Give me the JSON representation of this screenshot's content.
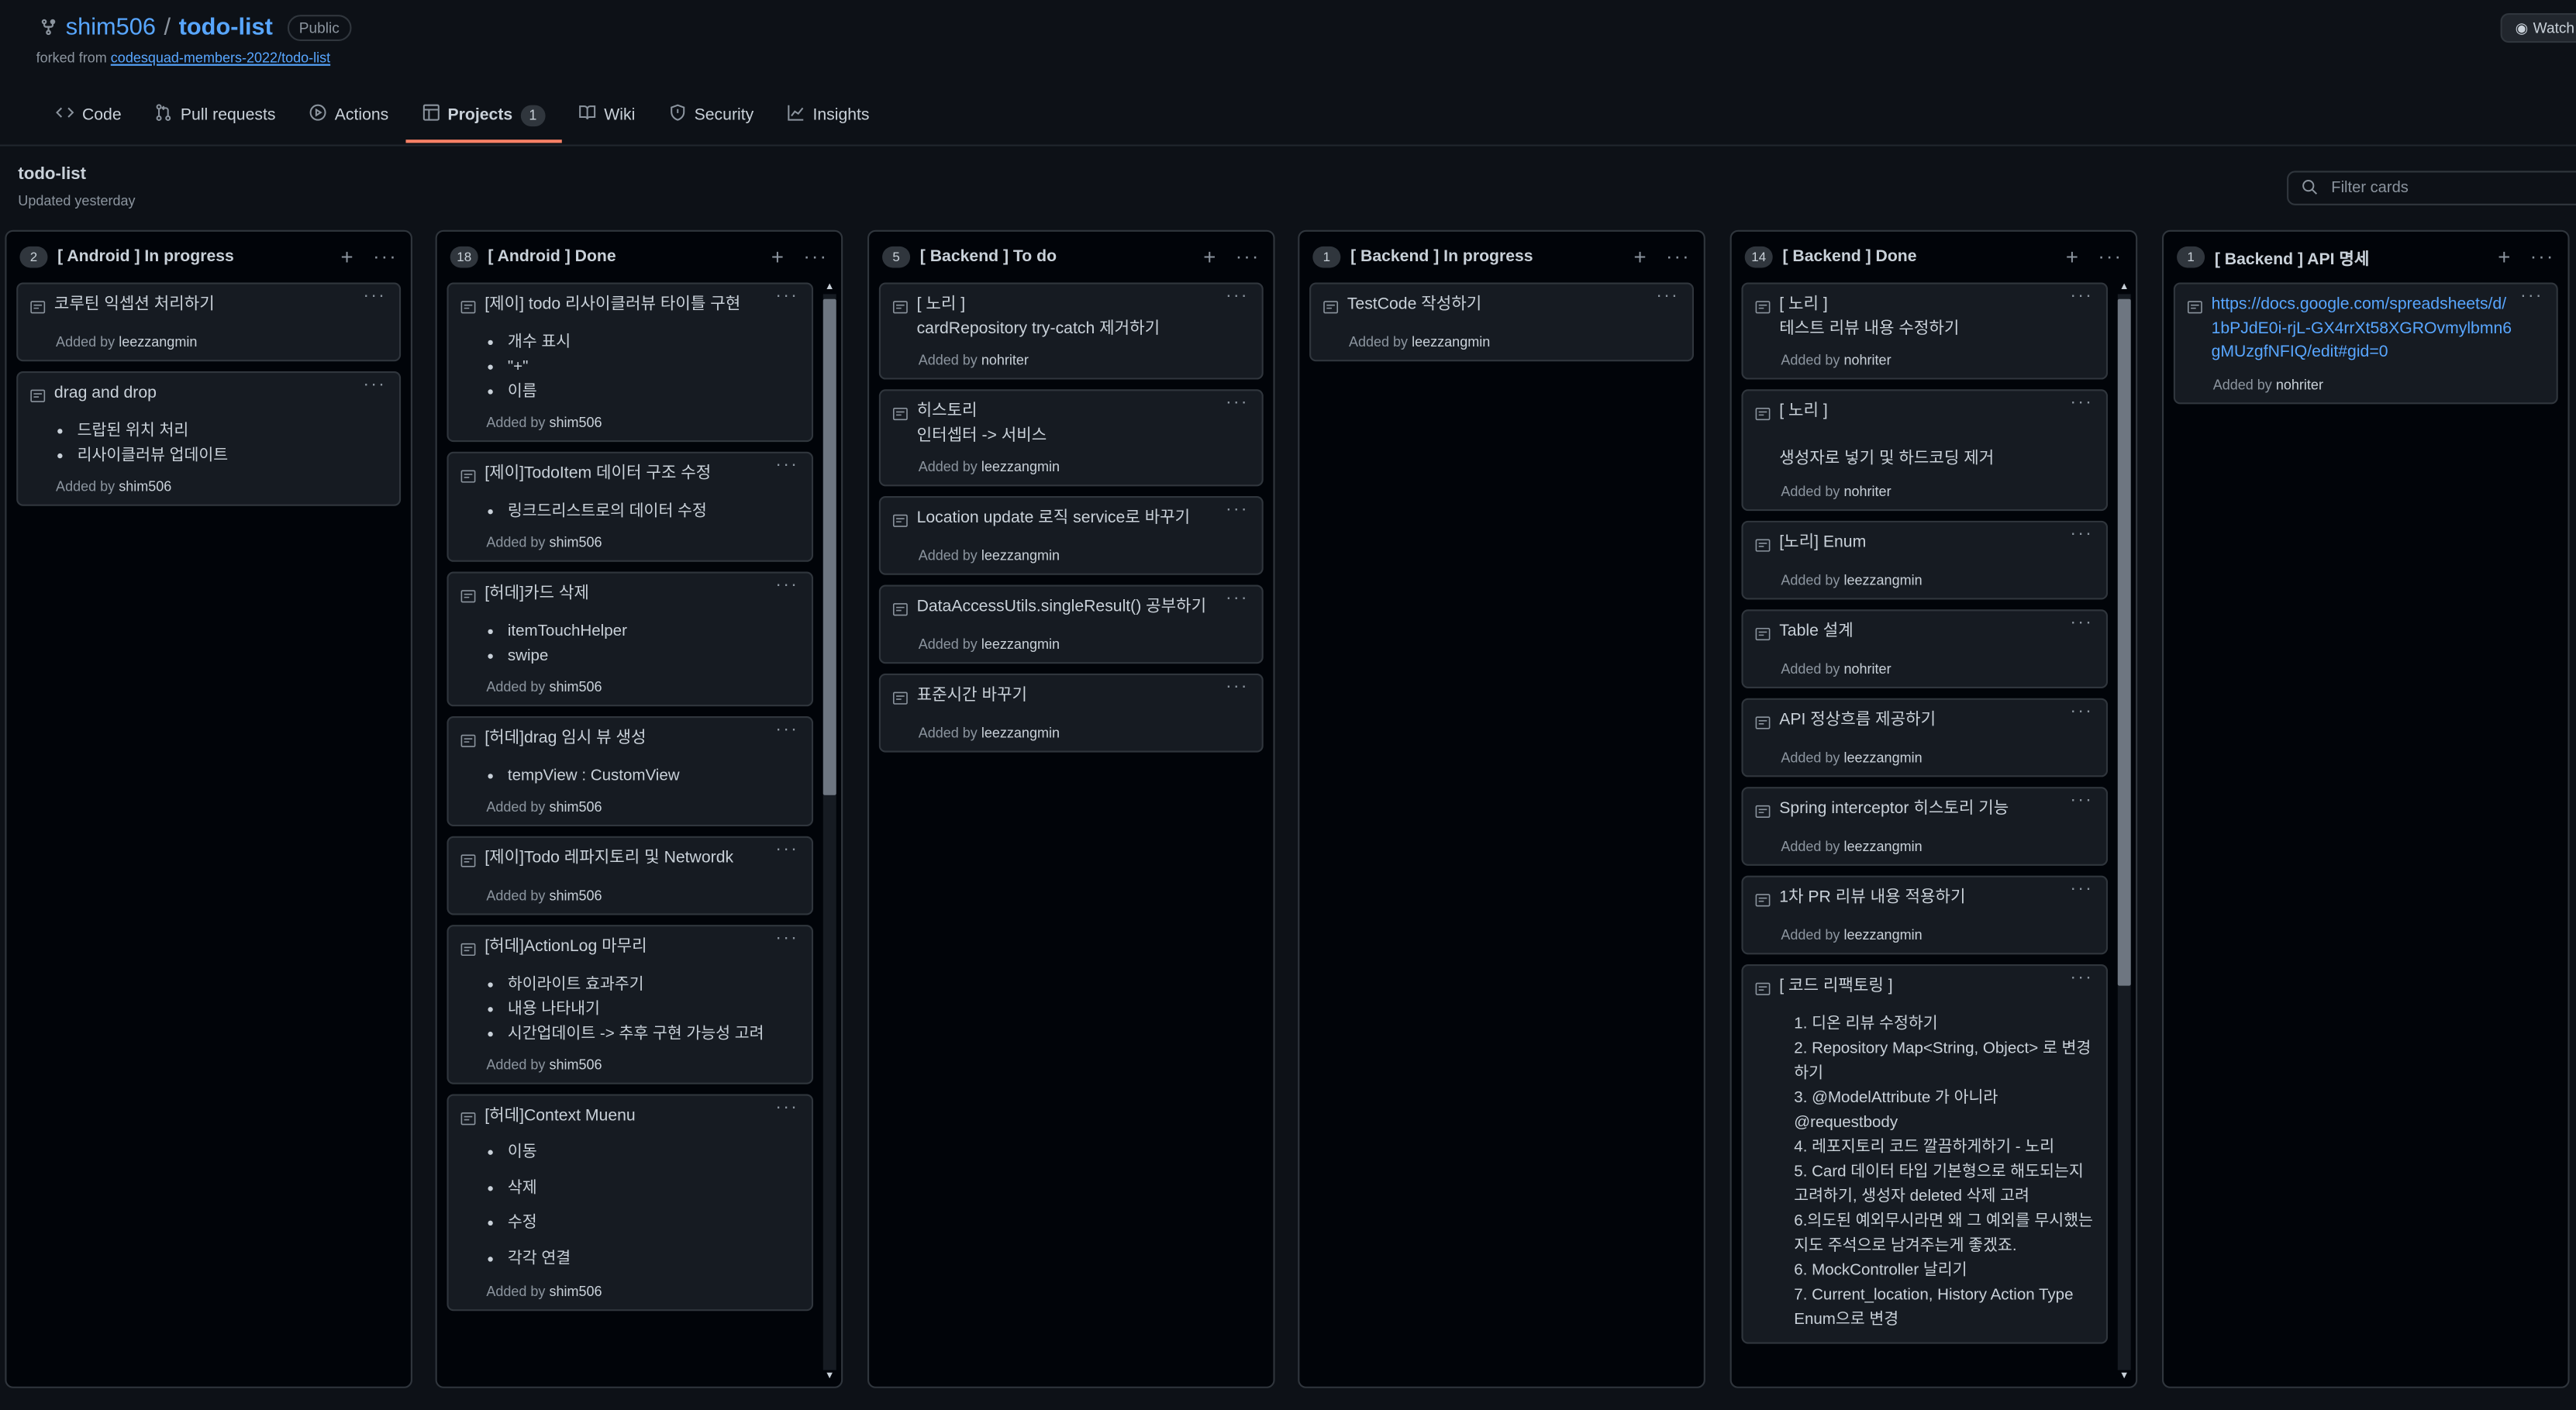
{
  "repo": {
    "owner": "shim506",
    "separator": "/",
    "name": "todo-list",
    "visibility": "Public",
    "forked_prefix": "forked from",
    "forked_link": "codesquad-members-2022/todo-list",
    "watch_label": "Watch"
  },
  "tabs": [
    {
      "label": "Code",
      "icon": "code-icon"
    },
    {
      "label": "Pull requests",
      "icon": "pull-request-icon"
    },
    {
      "label": "Actions",
      "icon": "play-icon"
    },
    {
      "label": "Projects",
      "icon": "table-icon",
      "count": "1",
      "active": true
    },
    {
      "label": "Wiki",
      "icon": "book-icon"
    },
    {
      "label": "Security",
      "icon": "shield-icon"
    },
    {
      "label": "Insights",
      "icon": "graph-icon"
    }
  ],
  "project": {
    "title": "todo-list",
    "updated": "Updated yesterday",
    "filter_placeholder": "Filter cards"
  },
  "added_by_prefix": "Added by",
  "columns": [
    {
      "count": "2",
      "name": "[ Android ] In progress",
      "cards": [
        {
          "title": "코루틴 익셉션 처리하기",
          "by": "leezzangmin"
        },
        {
          "title": "drag and drop",
          "items": [
            "드랍된 위치 처리",
            "리사이클러뷰 업데이트"
          ],
          "by": "shim506"
        }
      ]
    },
    {
      "count": "18",
      "name": "[ Android ] Done",
      "cards": [
        {
          "title": "[제이] todo 리사이클러뷰 타이틀 구현",
          "items": [
            "개수 표시",
            "\"+\"",
            "이름"
          ],
          "by": "shim506"
        },
        {
          "title": "[제이]TodoItem 데이터 구조 수정",
          "items": [
            "링크드리스트로의 데이터 수정"
          ],
          "by": "shim506"
        },
        {
          "title": "[허데]카드 삭제",
          "items": [
            "itemTouchHelper",
            "swipe"
          ],
          "by": "shim506"
        },
        {
          "title": "[허데]drag 임시 뷰 생성",
          "items": [
            "tempView : CustomView"
          ],
          "by": "shim506"
        },
        {
          "title": "[제이]Todo 레파지토리 및 Networdk",
          "by": "shim506"
        },
        {
          "title": "[허데]ActionLog 마무리",
          "items": [
            "하이라이트 효과주기",
            "내용 나타내기",
            "시간업데이트 -> 추후 구현 가능성 고려"
          ],
          "by": "shim506"
        },
        {
          "title": "[허데]Context Muenu",
          "items": [
            "이동",
            "삭제",
            "수정",
            "각각 연결"
          ],
          "wide": true,
          "by": "shim506"
        }
      ]
    },
    {
      "count": "5",
      "name": "[ Backend ] To do",
      "cards": [
        {
          "title": "[ 노리 ]\ncardRepository try-catch 제거하기",
          "by": "nohriter"
        },
        {
          "title": "히스토리\n인터셉터 -> 서비스",
          "by": "leezzangmin"
        },
        {
          "title": "Location update 로직 service로 바꾸기",
          "by": "leezzangmin"
        },
        {
          "title": "DataAccessUtils.singleResult() 공부하기",
          "by": "leezzangmin"
        },
        {
          "title": "표준시간 바꾸기",
          "by": "leezzangmin"
        }
      ]
    },
    {
      "count": "1",
      "name": "[ Backend ] In progress",
      "cards": [
        {
          "title": "TestCode 작성하기",
          "by": "leezzangmin"
        }
      ]
    },
    {
      "count": "14",
      "name": "[ Backend ] Done",
      "cards": [
        {
          "title": "[ 노리 ]\n테스트 리뷰 내용 수정하기",
          "by": "nohriter"
        },
        {
          "title": "[ 노리 ]\n\n생성자로 넣기 및 하드코딩 제거",
          "by": "nohriter"
        },
        {
          "title": "[노리] Enum",
          "by": "leezzangmin"
        },
        {
          "title": "Table 설계",
          "by": "nohriter"
        },
        {
          "title": "API 정상흐름 제공하기",
          "by": "leezzangmin"
        },
        {
          "title": "Spring interceptor 히스토리 기능",
          "by": "leezzangmin"
        },
        {
          "title": "1차 PR 리뷰 내용 적용하기",
          "by": "leezzangmin"
        },
        {
          "title": "[ 코드 리팩토링 ]",
          "ordered": [
            "1. 디온 리뷰 수정하기",
            "2. Repository Map<String, Object> 로 변경하기",
            "3. @ModelAttribute 가 아니라 @requestbody",
            "4. 레포지토리 코드 깔끔하게하기 - 노리",
            "5. Card 데이터 타입 기본형으로 해도되는지 고려하기, 생성자 deleted 삭제 고려",
            "6.의도된 예외무시라면 왜 그 예외를 무시했는지도 주석으로 남겨주는게 좋겠죠.",
            "6. MockController 날리기",
            "7. Current_location, History Action Type Enum으로 변경"
          ]
        }
      ]
    },
    {
      "count": "1",
      "name": "[ Backend ] API 명세",
      "cards": [
        {
          "link": "https://docs.google.com/spreadsheets/d/1bPJdE0i-rjL-GX4rrXt58XGROvmylbmn6gMUzgfNFIQ/edit#gid=0",
          "by": "nohriter"
        }
      ]
    }
  ],
  "colors": {
    "background": "#0d1117",
    "column": "#010409",
    "card": "#161b22",
    "border": "#30363d",
    "link": "#58a6ff",
    "active_tab": "#f78166"
  }
}
